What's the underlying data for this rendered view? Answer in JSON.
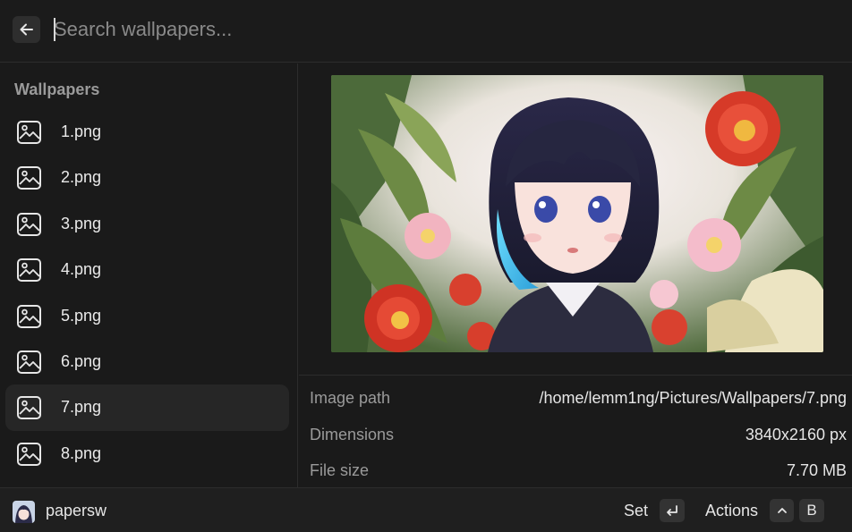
{
  "header": {
    "search_placeholder": "Search wallpapers...",
    "back_icon": "arrow-left-icon"
  },
  "sidebar": {
    "section_title": "Wallpapers",
    "items": [
      {
        "label": "1.png",
        "icon": "image-icon"
      },
      {
        "label": "2.png",
        "icon": "image-icon"
      },
      {
        "label": "3.png",
        "icon": "image-icon"
      },
      {
        "label": "4.png",
        "icon": "image-icon"
      },
      {
        "label": "5.png",
        "icon": "image-icon"
      },
      {
        "label": "6.png",
        "icon": "image-icon"
      },
      {
        "label": "7.png",
        "icon": "image-icon",
        "selected": true
      },
      {
        "label": "8.png",
        "icon": "image-icon"
      }
    ]
  },
  "details": {
    "rows": [
      {
        "key": "Image path",
        "value": "/home/lemm1ng/Pictures/Wallpapers/7.png"
      },
      {
        "key": "Dimensions",
        "value": "3840x2160 px"
      },
      {
        "key": "File size",
        "value": "7.70 MB"
      }
    ]
  },
  "footer": {
    "app_name": "papersw",
    "primary_action": "Set",
    "primary_shortcut_icon": "enter-key-icon",
    "secondary_action": "Actions",
    "secondary_shortcut_modifier_icon": "ctrl-caret-icon",
    "secondary_shortcut_key": "B"
  },
  "colors": {
    "background": "#1a1a1a",
    "selected_item": "#262626",
    "muted_text": "#9a9a9a",
    "text": "#e6e6e6"
  }
}
